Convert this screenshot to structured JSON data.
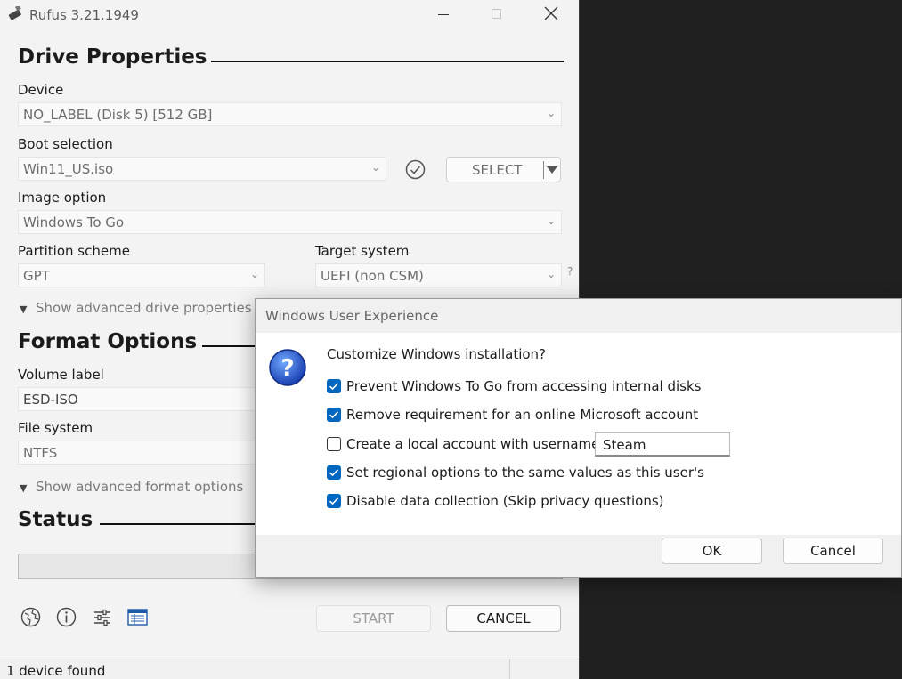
{
  "app": {
    "title": "Rufus 3.21.1949",
    "status": "1 device found"
  },
  "drive": {
    "heading": "Drive Properties",
    "device_label": "Device",
    "device_value": "NO_LABEL (Disk 5) [512 GB]",
    "boot_label": "Boot selection",
    "boot_value": "Win11_US.iso",
    "select_button": "SELECT",
    "image_option_label": "Image option",
    "image_option_value": "Windows To Go",
    "partition_label": "Partition scheme",
    "partition_value": "GPT",
    "target_label": "Target system",
    "target_value": "UEFI (non CSM)",
    "help": "?",
    "advanced": "Show advanced drive properties"
  },
  "format": {
    "heading": "Format Options",
    "volume_label": "Volume label",
    "volume_value": "ESD-ISO",
    "fs_label": "File system",
    "fs_value": "NTFS",
    "advanced": "Show advanced format options"
  },
  "status": {
    "heading": "Status"
  },
  "actions": {
    "start": "START",
    "cancel": "CANCEL"
  },
  "dialog": {
    "title": "Windows User Experience",
    "question": "Customize Windows installation?",
    "options": [
      {
        "label": "Prevent Windows To Go from accessing internal disks",
        "checked": true
      },
      {
        "label": "Remove requirement for an online Microsoft account",
        "checked": true
      },
      {
        "label": "Create a local account with username:",
        "checked": false
      },
      {
        "label": "Set regional options to the same values as this user's",
        "checked": true
      },
      {
        "label": "Disable data collection (Skip privacy questions)",
        "checked": true
      }
    ],
    "username_value": "Steam",
    "ok": "OK",
    "cancel": "Cancel"
  },
  "colors": {
    "accent": "#0067c0",
    "window_bg": "#f3f3f3",
    "desktop_bg": "#202020"
  },
  "icons": [
    "rufus-logo-icon",
    "minimize-icon",
    "maximize-icon",
    "close-icon",
    "check-circle-icon",
    "globe-icon",
    "info-icon",
    "settings-sliders-icon",
    "log-icon",
    "question-icon"
  ]
}
